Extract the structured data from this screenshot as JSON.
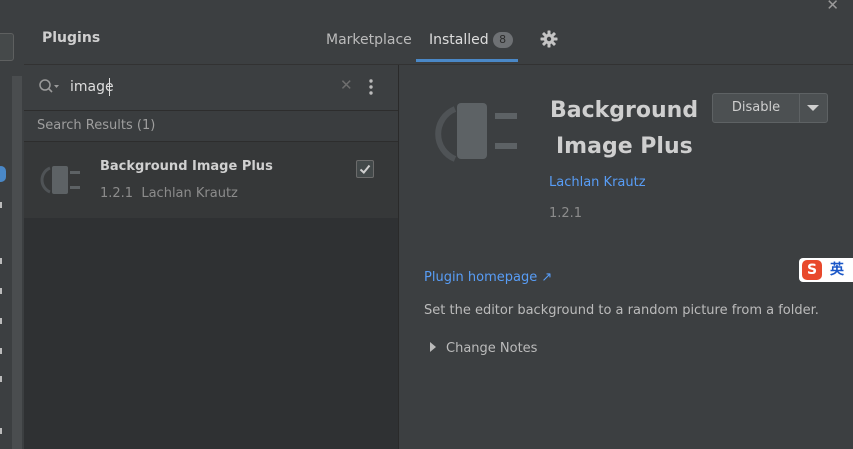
{
  "window": {
    "close_glyph": "✕"
  },
  "header": {
    "title": "Plugins",
    "tabs": [
      {
        "label": "Marketplace",
        "active": false
      },
      {
        "label": "Installed",
        "active": true,
        "badge": "8"
      }
    ],
    "settings_icon": "gear-icon"
  },
  "search": {
    "value": "image",
    "clear_glyph": "✕"
  },
  "results": {
    "header": "Search Results (1)",
    "items": [
      {
        "name": "Background Image Plus",
        "version": "1.2.1",
        "vendor": "Lachlan Krautz",
        "enabled": true
      }
    ]
  },
  "detail": {
    "title_line1": "Background",
    "title_line2": "Image Plus",
    "action_label": "Disable",
    "vendor": "Lachlan Krautz",
    "version": "1.2.1",
    "homepage_label": "Plugin homepage ↗",
    "description": "Set the editor background to a random picture from a folder.",
    "change_notes_label": "Change Notes"
  },
  "ime": {
    "logo": "S",
    "lang": "英"
  },
  "colors": {
    "accent": "#4a88c7",
    "link": "#589df6",
    "background": "#3c3f41",
    "list_background": "#2f3133"
  }
}
